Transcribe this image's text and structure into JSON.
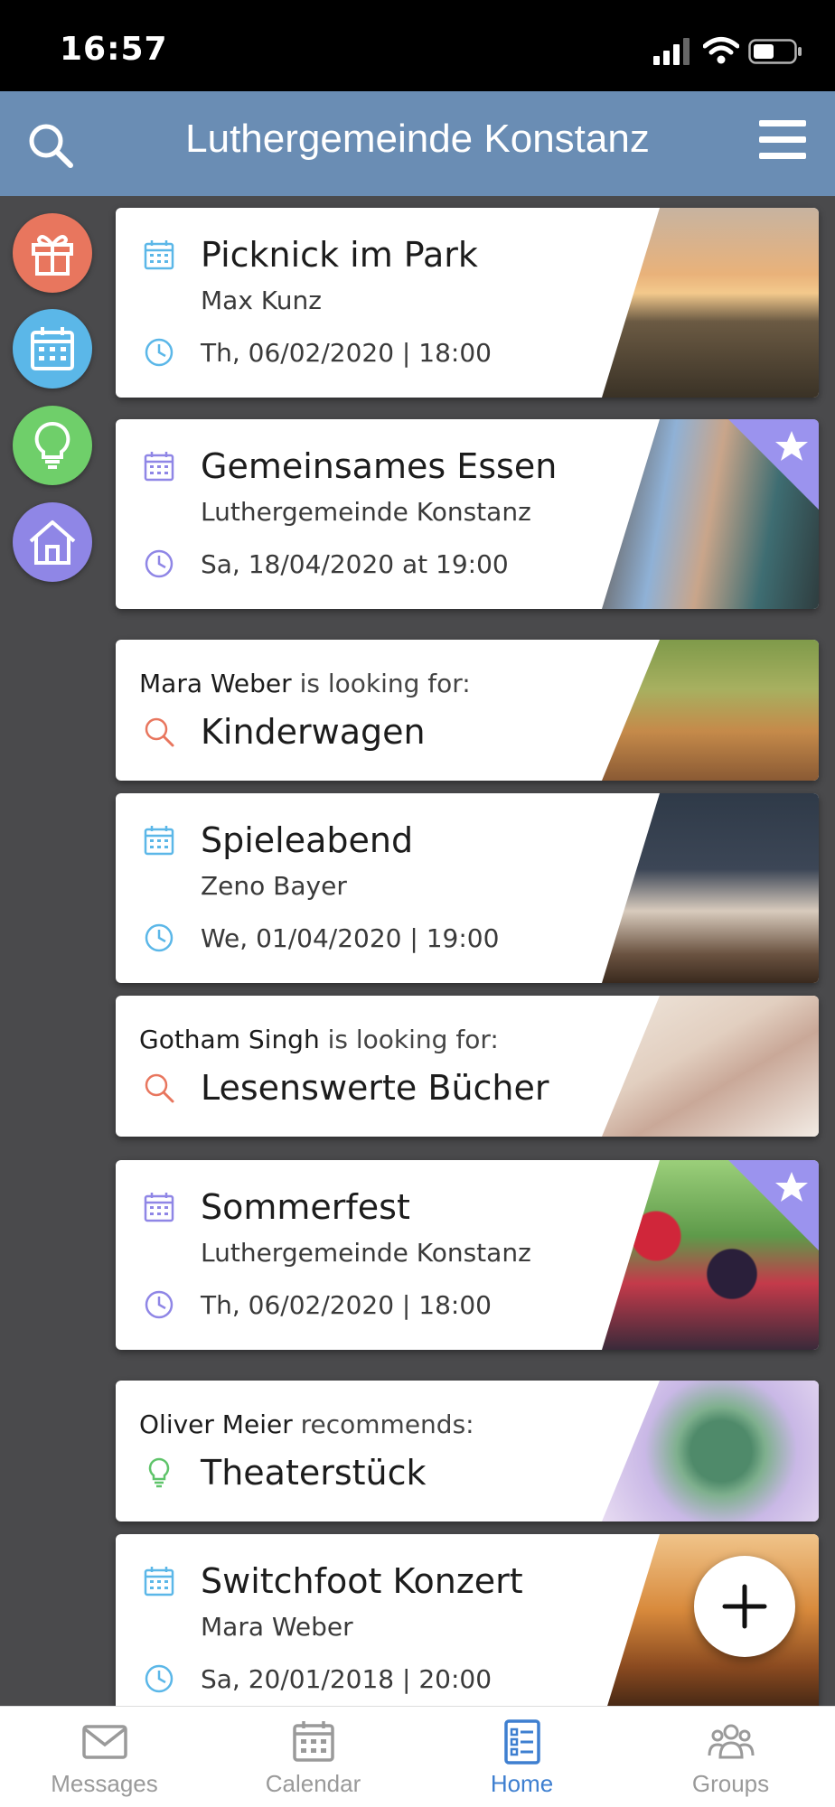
{
  "status": {
    "time": "16:57"
  },
  "header": {
    "title": "Luthergemeinde Konstanz"
  },
  "cards": [
    {
      "type": "event",
      "title": "Picknick im Park",
      "subtitle": "Max Kunz",
      "date": "Th, 06/02/2020 | 18:00",
      "accent": "#5bb7e8",
      "photo": "city picnic at sunset"
    },
    {
      "type": "event",
      "title": "Gemeinsames Essen",
      "subtitle": "Luthergemeinde Konstanz",
      "date": "Sa, 18/04/2020 at 19:00",
      "accent": "#8f86e6",
      "starred": true,
      "photo": "two women laughing"
    },
    {
      "type": "search",
      "name": "Mara Weber",
      "verb": "is looking for:",
      "title": "Kinderwagen",
      "accent": "#e8765e",
      "photo": "family walking in park"
    },
    {
      "type": "event",
      "title": "Spieleabend",
      "subtitle": "Zeno Bayer",
      "date": "We, 01/04/2020 | 19:00",
      "accent": "#5bb7e8",
      "photo": "woman playing chess"
    },
    {
      "type": "search",
      "name": "Gotham Singh",
      "verb": "is looking for:",
      "title": "Lesenswerte Bücher",
      "accent": "#e8765e",
      "photo": "open book pages"
    },
    {
      "type": "event",
      "title": "Sommerfest",
      "subtitle": "Luthergemeinde Konstanz",
      "date": "Th, 06/02/2020 | 18:00",
      "accent": "#8f86e6",
      "starred": true,
      "photo": "berries in water glasses"
    },
    {
      "type": "recommend",
      "name": "Oliver Meier",
      "verb": "recommends:",
      "title": "Theaterstück",
      "accent": "#5fc46a",
      "photo": "succulent plant"
    },
    {
      "type": "event",
      "title": "Switchfoot Konzert",
      "subtitle": "Mara Weber",
      "date": "Sa, 20/01/2018 | 20:00",
      "accent": "#5bb7e8",
      "photo": "concert crowd"
    }
  ],
  "side_buttons": [
    {
      "icon": "gift-icon",
      "color": "#e8765e"
    },
    {
      "icon": "calendar-icon",
      "color": "#5bb7e8"
    },
    {
      "icon": "lightbulb-icon",
      "color": "#6fcf6a"
    },
    {
      "icon": "home-icon",
      "color": "#8f86e6"
    }
  ],
  "nav": {
    "messages": "Messages",
    "calendar": "Calendar",
    "home": "Home",
    "groups": "Groups"
  },
  "colors": {
    "header": "#6a8db4",
    "active_nav": "#3e7fd0",
    "background": "#4a4a4c"
  }
}
